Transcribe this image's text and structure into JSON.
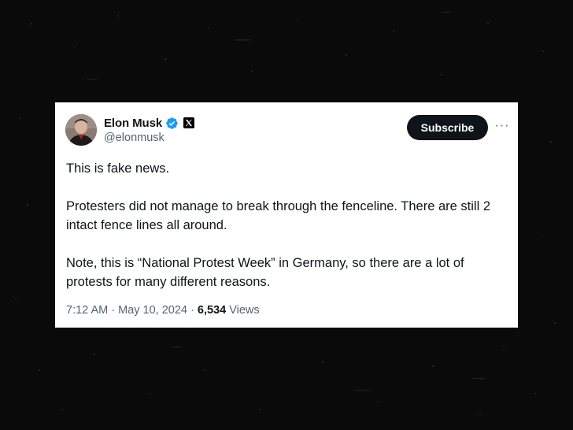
{
  "author": {
    "display_name": "Elon Musk",
    "handle": "@elonmusk",
    "verified_color": "#1d9bf0"
  },
  "actions": {
    "subscribe_label": "Subscribe",
    "more_label": "···"
  },
  "tweet": {
    "paragraphs": [
      "This is fake news.",
      "Protesters did not manage to break through the fenceline. There are still 2 intact fence lines all around.",
      "Note, this is “National Protest Week” in Germany, so there are a lot of protests for many different reasons."
    ],
    "time": "7:12 AM",
    "separator": "·",
    "date": "May 10, 2024",
    "views_count": "6,534",
    "views_label": "Views"
  },
  "colors": {
    "background": "#0a0a0a",
    "card": "#ffffff",
    "text_primary": "#0f1419",
    "text_secondary": "#536471",
    "button": "#0f1419"
  }
}
